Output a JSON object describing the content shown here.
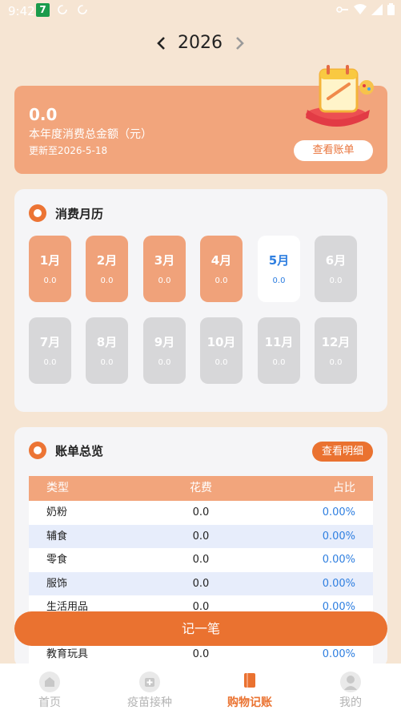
{
  "status_bar": {
    "time": "9:42",
    "app_badge": "7"
  },
  "year_switcher": {
    "prev_icon": "chevron-left",
    "year": "2026",
    "next_icon": "chevron-right"
  },
  "summary": {
    "amount": "0.0",
    "label": "本年度消费总金额（元）",
    "updated": "更新至2026-5-18",
    "view_bill_label": "查看账单"
  },
  "calendar": {
    "title": "消费月历",
    "months": [
      {
        "name": "1月",
        "value": "0.0",
        "state": "past"
      },
      {
        "name": "2月",
        "value": "0.0",
        "state": "past"
      },
      {
        "name": "3月",
        "value": "0.0",
        "state": "past"
      },
      {
        "name": "4月",
        "value": "0.0",
        "state": "past"
      },
      {
        "name": "5月",
        "value": "0.0",
        "state": "current"
      },
      {
        "name": "6月",
        "value": "0.0",
        "state": "future"
      },
      {
        "name": "7月",
        "value": "0.0",
        "state": "future"
      },
      {
        "name": "8月",
        "value": "0.0",
        "state": "future"
      },
      {
        "name": "9月",
        "value": "0.0",
        "state": "future"
      },
      {
        "name": "10月",
        "value": "0.0",
        "state": "future"
      },
      {
        "name": "11月",
        "value": "0.0",
        "state": "future"
      },
      {
        "name": "12月",
        "value": "0.0",
        "state": "future"
      }
    ]
  },
  "bill_overview": {
    "title": "账单总览",
    "detail_label": "查看明细",
    "headers": {
      "type": "类型",
      "cost": "花费",
      "ratio": "占比"
    },
    "rows": [
      {
        "type": "奶粉",
        "cost": "0.0",
        "ratio": "0.00%"
      },
      {
        "type": "辅食",
        "cost": "0.0",
        "ratio": "0.00%"
      },
      {
        "type": "零食",
        "cost": "0.0",
        "ratio": "0.00%"
      },
      {
        "type": "服饰",
        "cost": "0.0",
        "ratio": "0.00%"
      },
      {
        "type": "生活用品",
        "cost": "0.0",
        "ratio": "0.00%"
      },
      {
        "type": "",
        "cost": "",
        "ratio": ""
      },
      {
        "type": "教育玩具",
        "cost": "0.0",
        "ratio": "0.00%"
      }
    ]
  },
  "add_button_label": "记一笔",
  "bottom_nav": [
    {
      "label": "首页",
      "icon": "home-icon"
    },
    {
      "label": "疫苗接种",
      "icon": "vaccine-icon"
    },
    {
      "label": "购物记账",
      "icon": "ledger-icon",
      "active": true
    },
    {
      "label": "我的",
      "icon": "profile-icon"
    }
  ],
  "colors": {
    "accent": "#ea7230",
    "card": "#f2a57c",
    "background": "#f6e5d3",
    "current_month": "#2f7fe0"
  }
}
